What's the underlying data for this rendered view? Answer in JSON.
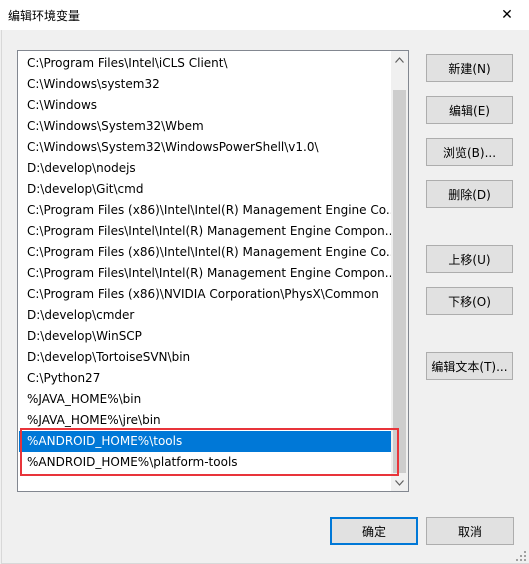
{
  "window": {
    "title": "编辑环境变量",
    "close_glyph": "✕"
  },
  "list": {
    "items": [
      "C:\\Program Files\\Intel\\iCLS Client\\",
      "C:\\Windows\\system32",
      "C:\\Windows",
      "C:\\Windows\\System32\\Wbem",
      "C:\\Windows\\System32\\WindowsPowerShell\\v1.0\\",
      "D:\\develop\\nodejs",
      "D:\\develop\\Git\\cmd",
      "C:\\Program Files (x86)\\Intel\\Intel(R) Management Engine Co...",
      "C:\\Program Files\\Intel\\Intel(R) Management Engine Compon...",
      "C:\\Program Files (x86)\\Intel\\Intel(R) Management Engine Co...",
      "C:\\Program Files\\Intel\\Intel(R) Management Engine Compon...",
      "C:\\Program Files (x86)\\NVIDIA Corporation\\PhysX\\Common",
      "D:\\develop\\cmder",
      "D:\\develop\\WinSCP",
      "D:\\develop\\TortoiseSVN\\bin",
      "C:\\Python27",
      "%JAVA_HOME%\\bin",
      "%JAVA_HOME%\\jre\\bin",
      "%ANDROID_HOME%\\tools",
      "%ANDROID_HOME%\\platform-tools"
    ],
    "selected_index": 18
  },
  "buttons": {
    "new": "新建(N)",
    "edit": "编辑(E)",
    "browse": "浏览(B)...",
    "delete": "删除(D)",
    "move_up": "上移(U)",
    "move_down": "下移(O)",
    "edit_text": "编辑文本(T)...",
    "ok": "确定",
    "cancel": "取消"
  },
  "colors": {
    "selection": "#0078d7",
    "highlight_border": "#e8343a"
  }
}
